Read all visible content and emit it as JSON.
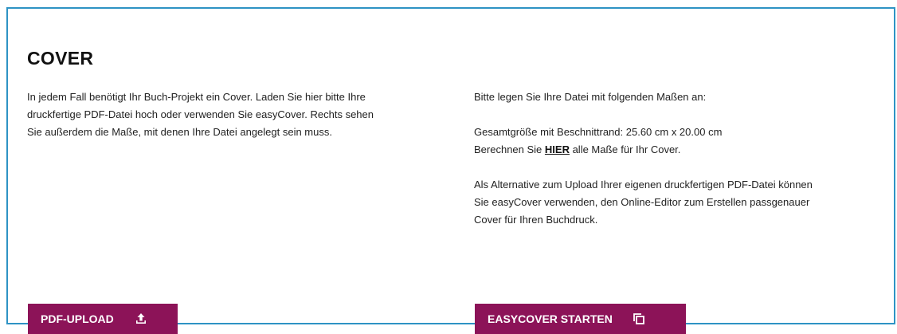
{
  "section": {
    "title": "COVER"
  },
  "left": {
    "line1": "In jedem Fall benötigt Ihr Buch-Projekt ein Cover. Laden Sie hier bitte Ihre",
    "line2": "druckfertige PDF-Datei hoch oder verwenden Sie easyCover. Rechts sehen",
    "line3": "Sie außerdem die Maße, mit denen Ihre Datei angelegt sein muss."
  },
  "right": {
    "intro": "Bitte legen Sie Ihre Datei mit folgenden Maßen an:",
    "size_line": "Gesamtgröße mit Beschnittrand: 25.60 cm x 20.00 cm",
    "calc_prefix": "Berechnen Sie ",
    "calc_link": "HIER",
    "calc_suffix": " alle Maße für Ihr Cover.",
    "alt_line1": "Als Alternative zum Upload Ihrer eigenen druckfertigen PDF-Datei können",
    "alt_line2": "Sie easyCover verwenden, den Online-Editor zum Erstellen passgenauer",
    "alt_line3": "Cover für Ihren Buchdruck."
  },
  "buttons": {
    "upload_label": "PDF-UPLOAD",
    "upload_icon": "upload-icon",
    "easycover_label": "EASYCOVER STARTEN",
    "easycover_icon": "copy-icon"
  },
  "colors": {
    "accent": "#8c1358",
    "border": "#2e93c4"
  }
}
